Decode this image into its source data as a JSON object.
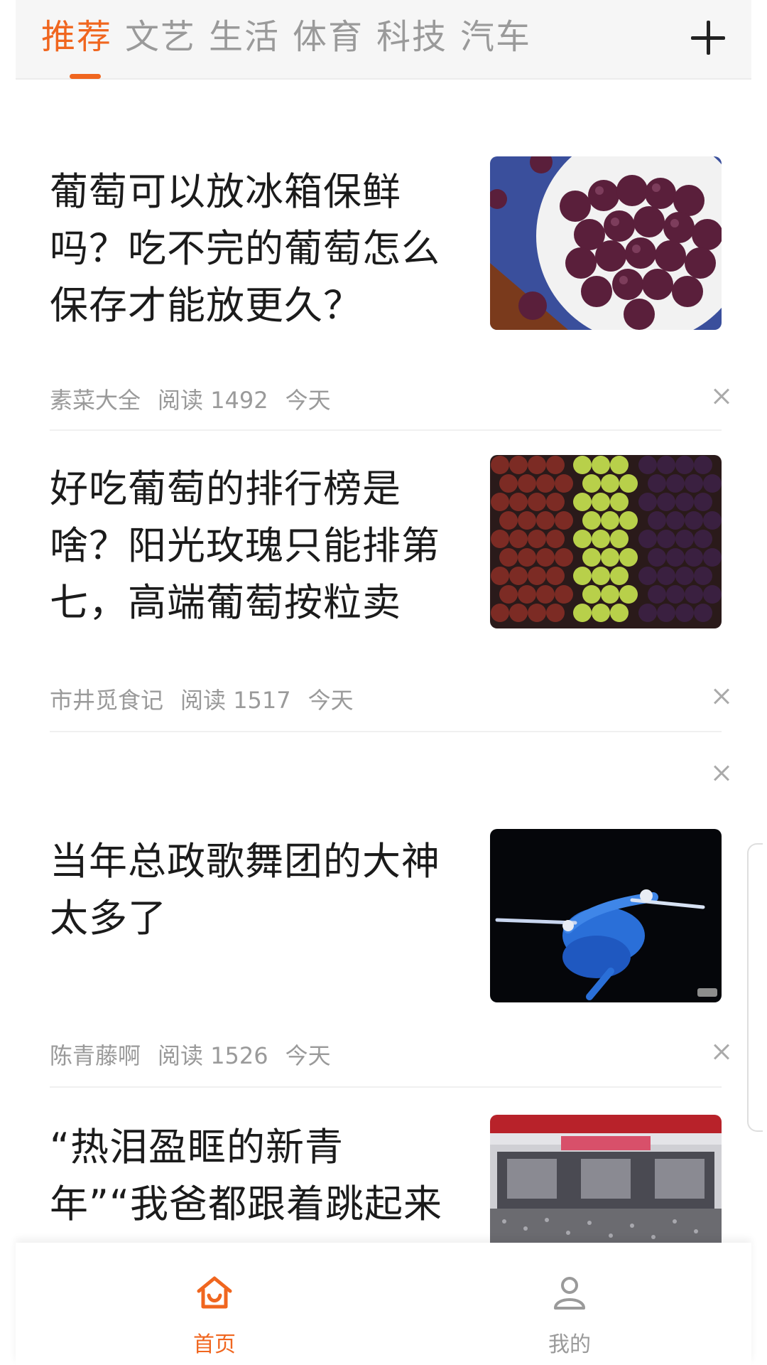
{
  "tabs": [
    {
      "label": "推荐",
      "active": true
    },
    {
      "label": "文艺",
      "active": false
    },
    {
      "label": "生活",
      "active": false
    },
    {
      "label": "体育",
      "active": false
    },
    {
      "label": "科技",
      "active": false
    },
    {
      "label": "汽车",
      "active": false
    }
  ],
  "add_tab_icon": "plus-icon",
  "articles": [
    {
      "title": "葡萄可以放冰箱保鲜吗？吃不完的葡萄怎么保存才能放更久？",
      "source": "素菜大全",
      "reads": "阅读 1492",
      "time": "今天",
      "thumb": "grapes-bowl-photo"
    },
    {
      "title": "好吃葡萄的排行榜是啥？阳光玫瑰只能排第七，高端葡萄按粒卖",
      "source": "市井觅食记",
      "reads": "阅读 1517",
      "time": "今天",
      "thumb": "grape-varieties-photo"
    },
    {
      "title": "当年总政歌舞团的大神太多了",
      "source": "陈青藤啊",
      "reads": "阅读 1526",
      "time": "今天",
      "thumb": "dancers-photo"
    },
    {
      "title": "“热泪盈眶的新青年”“我爸都跟着跳起来了”…",
      "thumb": "concert-stadium-photo"
    }
  ],
  "bottom_nav": [
    {
      "label": "首页",
      "icon": "home-icon",
      "active": true
    },
    {
      "label": "我的",
      "icon": "user-icon",
      "active": false
    }
  ],
  "colors": {
    "accent": "#f0661f",
    "inactive_text": "#9a9a9a",
    "title_text": "#1b1b1b"
  }
}
